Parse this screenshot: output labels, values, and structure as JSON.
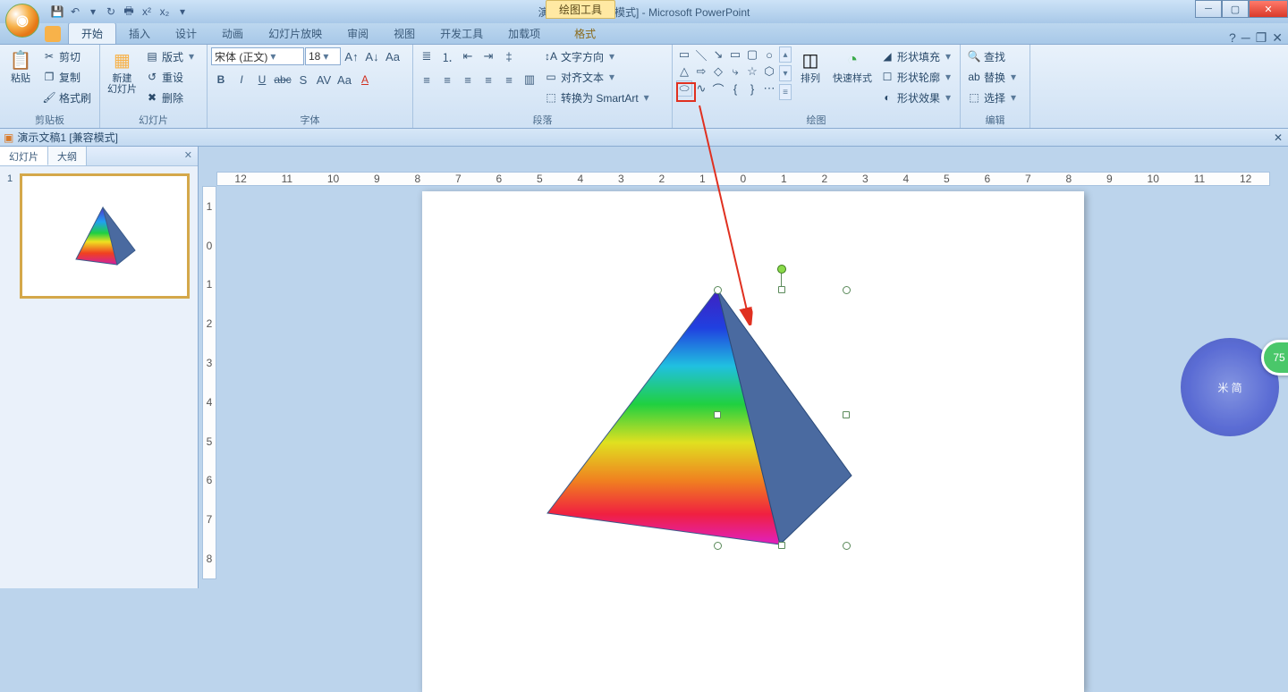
{
  "title": "演示文稿1 [兼容模式] - Microsoft PowerPoint",
  "context_tab": "绘图工具",
  "doc_title": "演示文稿1 [兼容模式]",
  "tabs": {
    "home": "开始",
    "insert": "插入",
    "design": "设计",
    "anim": "动画",
    "slideshow": "幻灯片放映",
    "review": "审阅",
    "view": "视图",
    "dev": "开发工具",
    "addins": "加载项",
    "format": "格式"
  },
  "groups": {
    "clipboard": "剪贴板",
    "slides": "幻灯片",
    "font": "字体",
    "paragraph": "段落",
    "drawing": "绘图",
    "editing": "编辑"
  },
  "clipboard": {
    "paste": "粘贴",
    "cut": "剪切",
    "copy": "复制",
    "painter": "格式刷"
  },
  "slides": {
    "newslide": "新建\n幻灯片",
    "layout": "版式",
    "reset": "重设",
    "delete": "删除"
  },
  "font": {
    "name": "宋体 (正文)",
    "size": "18"
  },
  "paragraph": {
    "dir": "文字方向",
    "align": "对齐文本",
    "smartart": "转换为 SmartArt"
  },
  "drawing": {
    "arrange": "排列",
    "quick": "快速样式",
    "fill": "形状填充",
    "outline": "形状轮廓",
    "effects": "形状效果"
  },
  "editing": {
    "find": "查找",
    "replace": "替换",
    "select": "选择"
  },
  "nav": {
    "slides_tab": "幻灯片",
    "outline_tab": "大纲",
    "slide_num": "1"
  },
  "ruler_h": [
    "12",
    "11",
    "10",
    "9",
    "8",
    "7",
    "6",
    "5",
    "4",
    "3",
    "2",
    "1",
    "0",
    "1",
    "2",
    "3",
    "4",
    "5",
    "6",
    "7",
    "8",
    "9",
    "10",
    "11",
    "12"
  ],
  "ruler_v": [
    "1",
    "0",
    "1",
    "2",
    "3",
    "4",
    "5",
    "6",
    "7",
    "8"
  ],
  "badge": "75",
  "wm_text": "米 简"
}
